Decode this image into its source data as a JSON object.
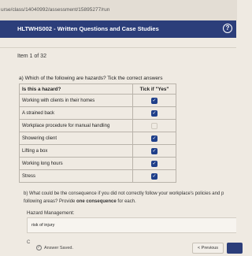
{
  "browser": {
    "url": "urse/class/14040992/assessment/15895277/run"
  },
  "header": {
    "title": "HLTWHS002 - Written Questions and Case Studies",
    "help_glyph": "?"
  },
  "progress": {
    "item_label": "Item 1 of 32"
  },
  "question_a": {
    "prompt": "a) Which of the following are hazards? Tick the correct answers",
    "columns": [
      "Is this a hazard?",
      "Tick if \"Yes\""
    ],
    "rows": [
      {
        "label": "Working with clients in their homes",
        "ticked": true
      },
      {
        "label": "A strained back",
        "ticked": true
      },
      {
        "label": "Workplace procedure for manual handling",
        "ticked": false
      },
      {
        "label": "Showering client",
        "ticked": true
      },
      {
        "label": "Lifting a box",
        "ticked": true
      },
      {
        "label": "Working long hours",
        "ticked": true
      },
      {
        "label": "Stress",
        "ticked": true
      }
    ]
  },
  "question_b": {
    "line1": "b) What could be the consequence if you did not correctly follow your workplace's policies and p",
    "line2_prefix": "following areas? Provide ",
    "line2_bold": "one consequence",
    "line2_suffix": " for each."
  },
  "hazard_management": {
    "label": "Hazard Management:",
    "answer": "risk of injury"
  },
  "footer": {
    "stray_char": "C",
    "saved_text": "Answer Saved.",
    "previous_label": "< Previous"
  },
  "colors": {
    "header_bg": "#2c3e7a",
    "checkbox": "#1f3f8a",
    "page_bg": "#efeae2"
  }
}
